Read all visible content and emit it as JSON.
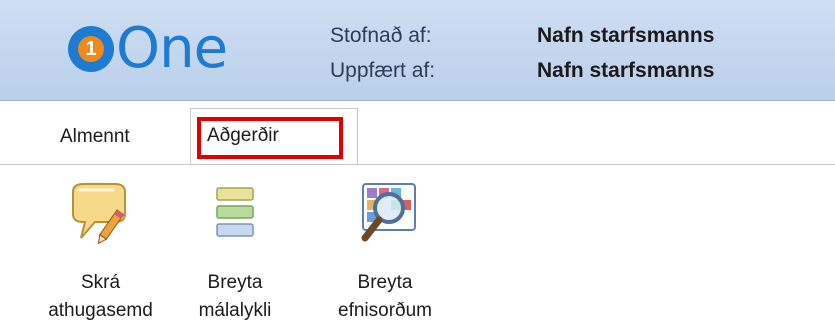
{
  "header": {
    "logo_text": "One",
    "logo_digit": "1",
    "created_by_label": "Stofnað af:",
    "updated_by_label": "Uppfært af:",
    "created_by_value": "Nafn starfsmanns",
    "updated_by_value": "Nafn starfsmanns"
  },
  "tabs": [
    {
      "label": "Almennt"
    },
    {
      "label": "Aðgerðir"
    }
  ],
  "actions": [
    {
      "line1": "Skrá",
      "line2": "athugasemd",
      "icon": "comment-pencil-icon"
    },
    {
      "line1": "Breyta",
      "line2": "málalykli",
      "icon": "list-icon"
    },
    {
      "line1": "Breyta",
      "line2": "efnisorðum",
      "icon": "magnifier-icon"
    }
  ],
  "colors": {
    "header_bg": "#c5d8ef",
    "highlight": "#e10000",
    "logo_blue": "#1e7bd1",
    "logo_orange": "#f08a1c"
  }
}
